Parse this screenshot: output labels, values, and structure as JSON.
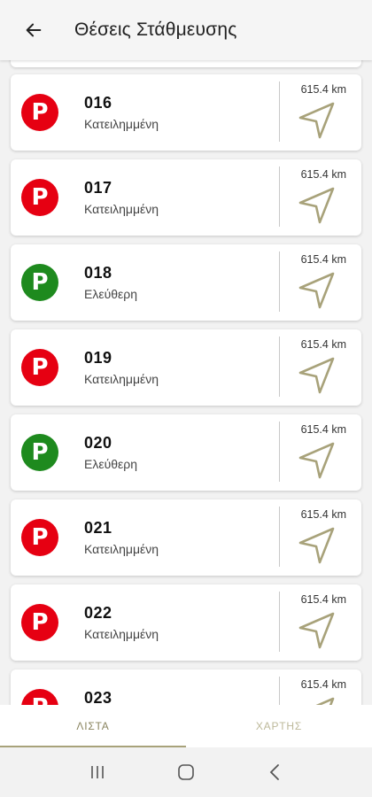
{
  "header": {
    "title": "Θέσεις Στάθμευσης"
  },
  "colors": {
    "occupied": "#e60012",
    "free": "#1e8a1e",
    "accent": "#8a8560",
    "nav_icon": "#a8a27a"
  },
  "spots": [
    {
      "number": "016",
      "status": "Κατειλημμένη",
      "state": "occupied",
      "distance": "615.4 km"
    },
    {
      "number": "017",
      "status": "Κατειλημμένη",
      "state": "occupied",
      "distance": "615.4 km"
    },
    {
      "number": "018",
      "status": "Ελεύθερη",
      "state": "free",
      "distance": "615.4 km"
    },
    {
      "number": "019",
      "status": "Κατειλημμένη",
      "state": "occupied",
      "distance": "615.4 km"
    },
    {
      "number": "020",
      "status": "Ελεύθερη",
      "state": "free",
      "distance": "615.4 km"
    },
    {
      "number": "021",
      "status": "Κατειλημμένη",
      "state": "occupied",
      "distance": "615.4 km"
    },
    {
      "number": "022",
      "status": "Κατειλημμένη",
      "state": "occupied",
      "distance": "615.4 km"
    },
    {
      "number": "023",
      "status": "",
      "state": "occupied",
      "distance": "615.4 km"
    }
  ],
  "tabs": {
    "list": "ΛΙΣΤΑ",
    "map": "ΧΑΡΤΗΣ"
  },
  "icons": {
    "back": "arrow-left-icon",
    "navigate": "navigation-arrow-icon",
    "parking": "parking-p-icon"
  }
}
